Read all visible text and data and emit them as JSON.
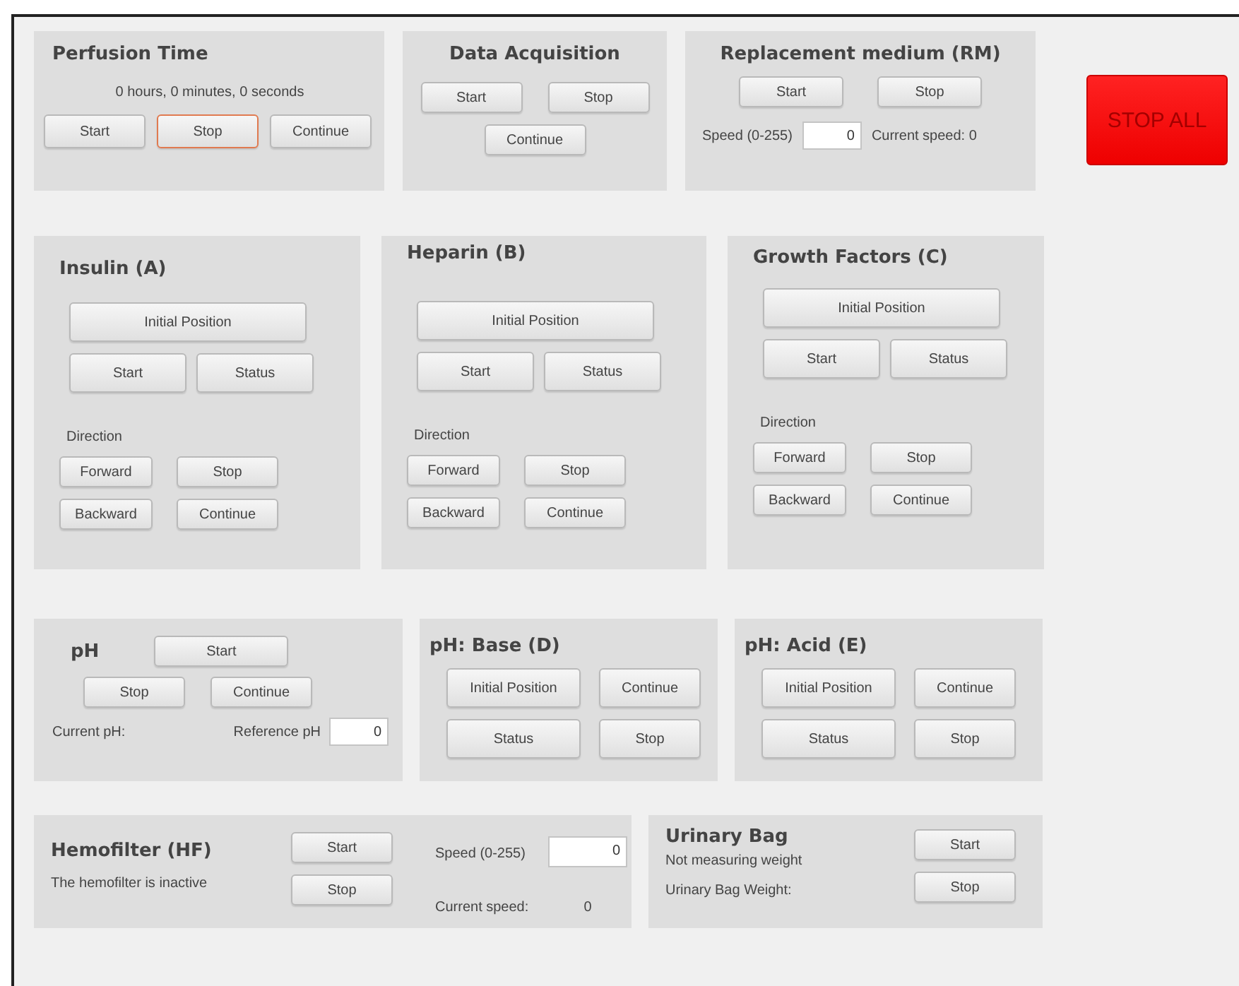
{
  "perfusion_time": {
    "title": "Perfusion Time",
    "elapsed": "0 hours, 0 minutes, 0 seconds",
    "buttons": [
      {
        "label": "Start",
        "focused": false
      },
      {
        "label": "Stop",
        "focused": true
      },
      {
        "label": "Continue",
        "focused": false
      }
    ]
  },
  "data_acquisition": {
    "title": "Data Acquisition",
    "buttons": [
      "Start",
      "Stop",
      "Continue"
    ]
  },
  "replacement_medium": {
    "title": "Replacement medium (RM)",
    "buttons": [
      "Start",
      "Stop"
    ],
    "speed_label": "Speed (0-255)",
    "speed_value": "0",
    "current_speed": "Current speed: 0"
  },
  "stop_all": "STOP ALL",
  "pumps": [
    {
      "title": "Insulin (A)",
      "initial_button": "Initial Position",
      "buttons": [
        "Start",
        "Status"
      ],
      "direction_label": "Direction",
      "direction_buttons": [
        "Forward",
        "Stop",
        "Backward",
        "Continue"
      ]
    },
    {
      "title": "Heparin (B)",
      "initial_button": "Initial Position",
      "buttons": [
        "Start",
        "Status"
      ],
      "direction_label": "Direction",
      "direction_buttons": [
        "Forward",
        "Stop",
        "Backward",
        "Continue"
      ]
    },
    {
      "title": "Growth Factors (C)",
      "initial_button": "Initial Position",
      "buttons": [
        "Start",
        "Status"
      ],
      "direction_label": "Direction",
      "direction_buttons": [
        "Forward",
        "Stop",
        "Backward",
        "Continue"
      ]
    }
  ],
  "ph": {
    "title": "pH",
    "buttons": [
      "Start",
      "Stop",
      "Continue"
    ],
    "current_label": "Current pH:",
    "reference_label": "Reference pH",
    "reference_value": "0"
  },
  "ph_pumps": [
    {
      "title": "pH: Base (D)",
      "buttons": [
        "Initial Position",
        "Continue",
        "Status",
        "Stop"
      ]
    },
    {
      "title": "pH: Acid (E)",
      "buttons": [
        "Initial Position",
        "Continue",
        "Status",
        "Stop"
      ]
    }
  ],
  "hemofilter": {
    "title": "Hemofilter (HF)",
    "status": "The hemofilter is inactive",
    "buttons": [
      "Start",
      "Stop"
    ],
    "speed_label": "Speed (0-255)",
    "speed_value": "0",
    "current_speed_label": "Current speed:",
    "current_speed": "0"
  },
  "urinary_bag": {
    "title": "Urinary Bag",
    "status": "Not measuring weight",
    "weight_label": "Urinary Bag Weight:",
    "buttons": [
      "Start",
      "Stop"
    ]
  }
}
